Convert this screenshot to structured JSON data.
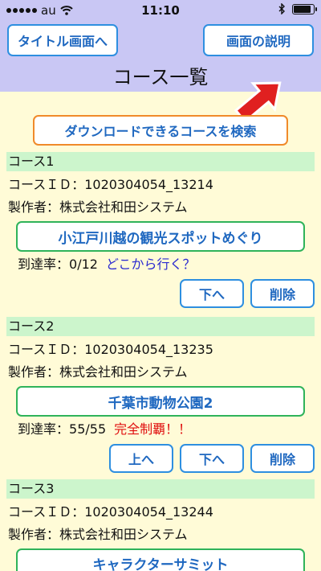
{
  "status": {
    "carrier": "au",
    "time": "11:10"
  },
  "header": {
    "back_label": "タイトル画面へ",
    "help_label": "画面の説明",
    "title": "コース一覧"
  },
  "search_label": "ダウンロードできるコースを検索",
  "arrow_color": "#e02020",
  "labels": {
    "course_id_prefix": "コースＩＤ：",
    "maker_prefix": "製作者：",
    "rate_prefix": "到達率：",
    "up": "上へ",
    "down": "下へ",
    "delete": "削除"
  },
  "courses": [
    {
      "header": "コース1",
      "id": "1020304054_13214",
      "maker": "株式会社和田システム",
      "name": "小江戸川越の観光スポットめぐり",
      "rate": "0/12",
      "note": "どこから行く？"
    },
    {
      "header": "コース2",
      "id": "1020304054_13235",
      "maker": "株式会社和田システム",
      "name": "千葉市動物公園2",
      "rate": "55/55",
      "note": "完全制覇！！"
    },
    {
      "header": "コース3",
      "id": "1020304054_13244",
      "maker": "株式会社和田システム",
      "name": "キャラクターサミット"
    }
  ]
}
